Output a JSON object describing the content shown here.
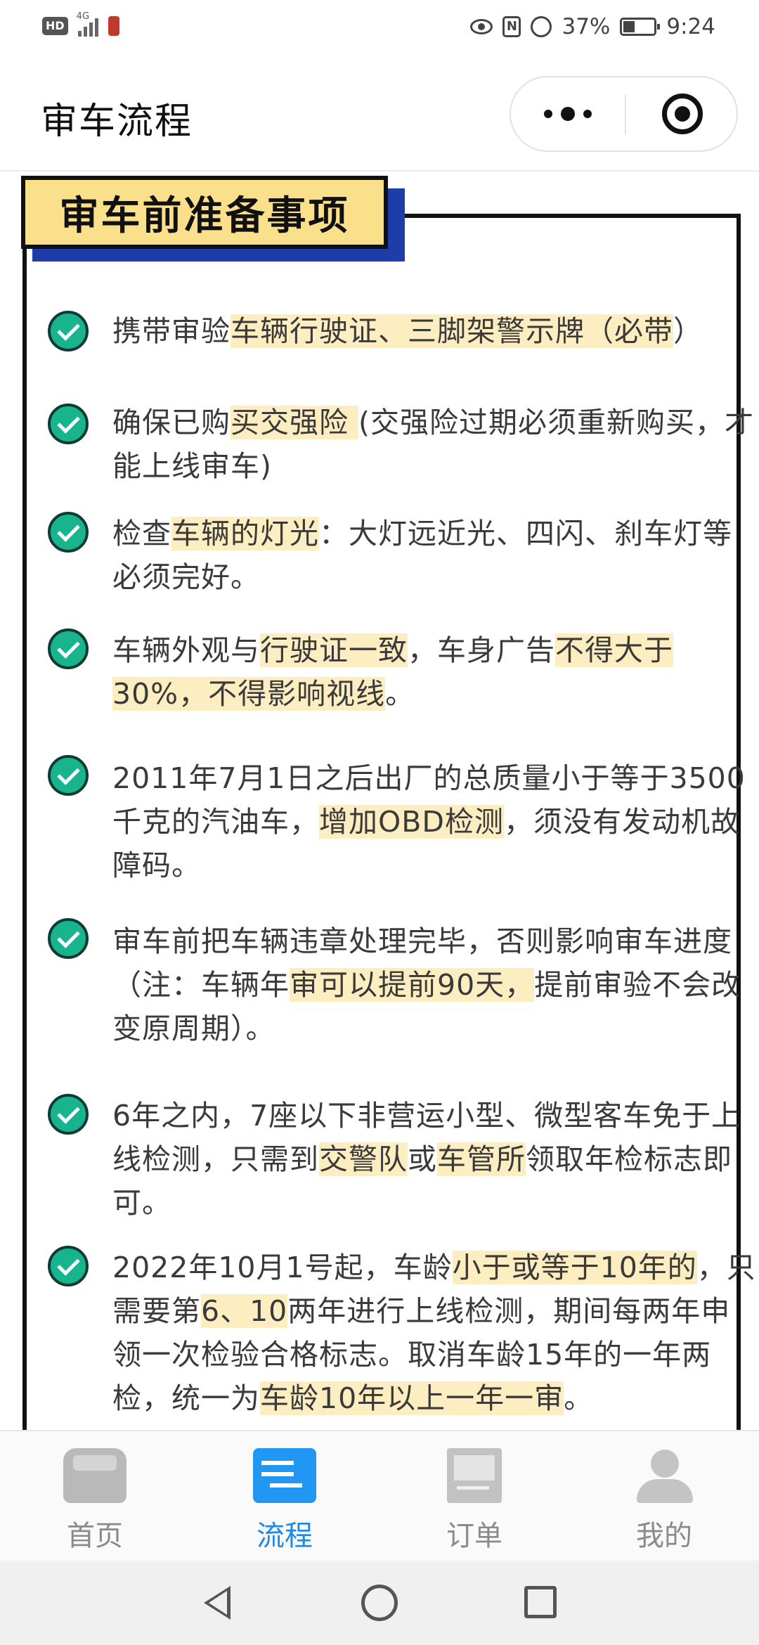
{
  "status_bar": {
    "hd_badge": "HD",
    "network": "4G",
    "battery_percent": "37%",
    "time": "9:24"
  },
  "header": {
    "title": "审车流程",
    "more_icon": "more-dots-icon",
    "close_icon": "target-circle-icon"
  },
  "card": {
    "title": "审车前准备事项",
    "items": [
      [
        {
          "t": "携带审验",
          "h": false
        },
        {
          "t": "车辆行驶证、三脚架警示牌（必带",
          "h": true
        },
        {
          "t": "）",
          "h": false
        }
      ],
      [
        {
          "t": "确保已购",
          "h": false
        },
        {
          "t": "买交强险 ",
          "h": true
        },
        {
          "t": "(交强险过期必须重新购买，才能上线审车)",
          "h": false
        }
      ],
      [
        {
          "t": "检查",
          "h": false
        },
        {
          "t": "车辆的灯光",
          "h": true
        },
        {
          "t": "：大灯远近光、四闪、刹车灯等必须完好。",
          "h": false
        }
      ],
      [
        {
          "t": "车辆外观与",
          "h": false
        },
        {
          "t": "行驶证一致",
          "h": true
        },
        {
          "t": "，车身广告",
          "h": false
        },
        {
          "t": "不得大于30%，不得影响视线",
          "h": true
        },
        {
          "t": "。",
          "h": false
        }
      ],
      [
        {
          "t": "2011年7月1日之后出厂的总质量小于等于3500千克的汽油车，",
          "h": false
        },
        {
          "t": "增加OBD检测",
          "h": true
        },
        {
          "t": "，须没有发动机故障码。",
          "h": false
        }
      ],
      [
        {
          "t": "审车前把车辆违章处理完毕，否则影响审车进度（注：车辆年",
          "h": false
        },
        {
          "t": "审可以提前90天，",
          "h": true
        },
        {
          "t": "提前审验不会改变原周期）。",
          "h": false
        }
      ],
      [
        {
          "t": "6年之内，7座以下非营运小型、微型客车免于上线检测，只需到",
          "h": false
        },
        {
          "t": "交警队",
          "h": true
        },
        {
          "t": "或",
          "h": false
        },
        {
          "t": "车管所",
          "h": true
        },
        {
          "t": "领取年检标志即可。",
          "h": false
        }
      ],
      [
        {
          "t": "2022年10月1号起，车龄",
          "h": false
        },
        {
          "t": "小于或等于10年的",
          "h": true
        },
        {
          "t": "，只需要第",
          "h": false
        },
        {
          "t": "6、10",
          "h": true
        },
        {
          "t": "两年进行上线检测，期间每两年申领一次检验合格标志。取消车龄15年的一年两检，统一为",
          "h": false
        },
        {
          "t": "车龄10年以上一年一审",
          "h": true
        },
        {
          "t": "。",
          "h": false
        }
      ]
    ]
  },
  "tabbar": {
    "tabs": [
      {
        "label": "首页",
        "icon": "car-icon",
        "active": false
      },
      {
        "label": "流程",
        "icon": "flow-icon",
        "active": true
      },
      {
        "label": "订单",
        "icon": "order-icon",
        "active": false
      },
      {
        "label": "我的",
        "icon": "user-icon",
        "active": false
      }
    ],
    "active_color": "#1e88e5",
    "inactive_color": "#8a8a8a"
  },
  "colors": {
    "highlight": "#fdeec2",
    "header_fill": "#fbe08c",
    "header_shadow": "#1f3da8",
    "check_green": "#18b48e"
  }
}
